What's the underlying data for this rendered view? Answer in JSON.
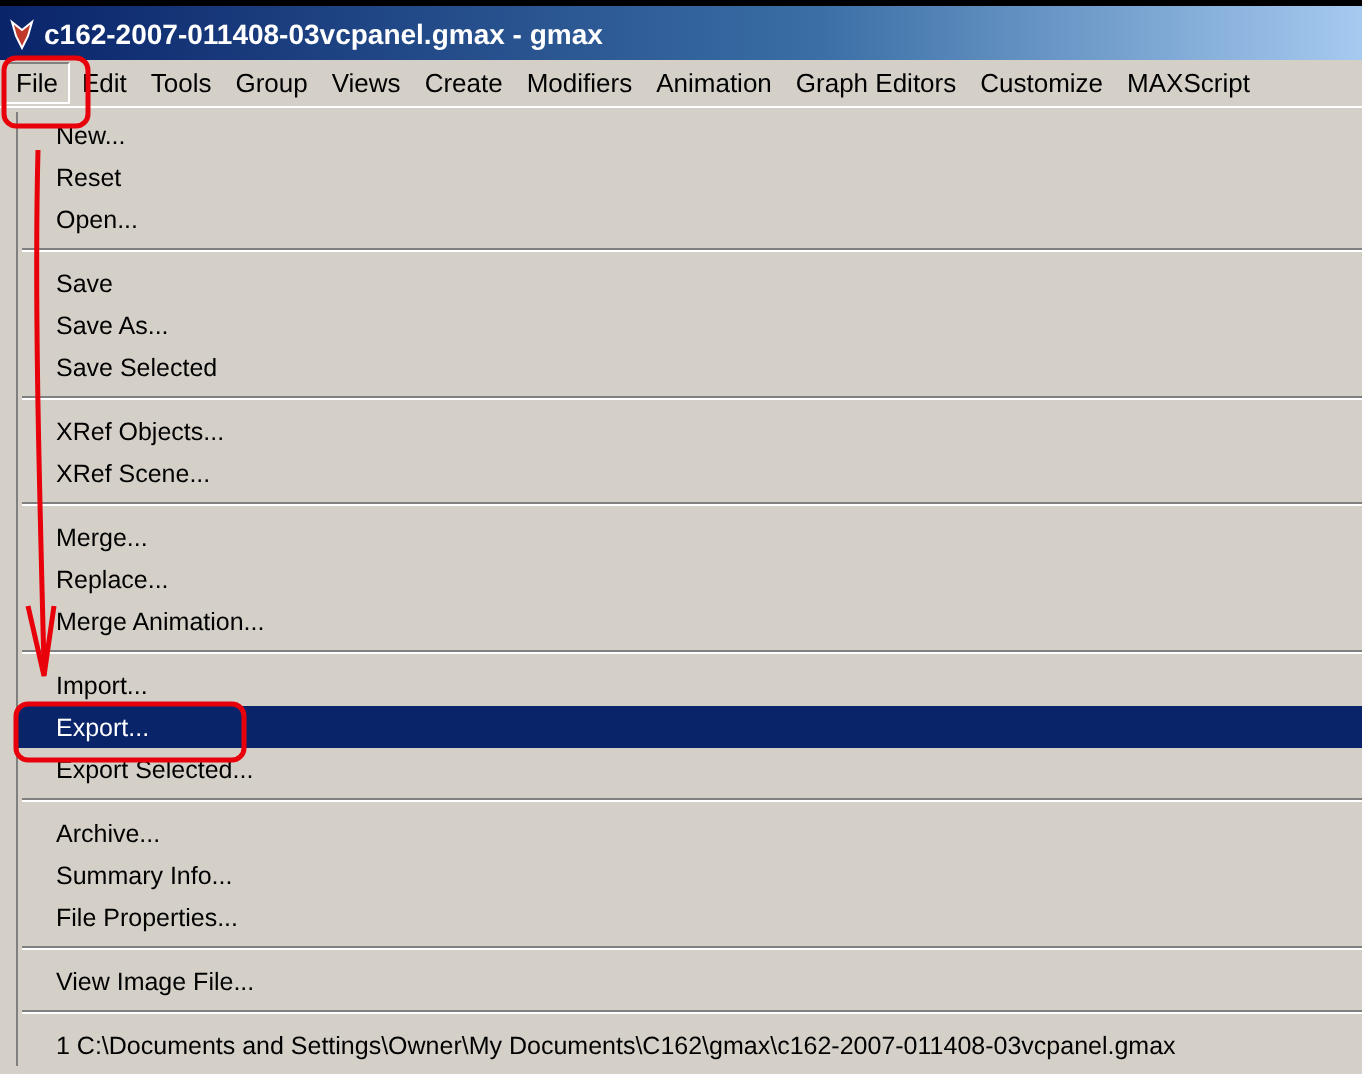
{
  "window": {
    "title": "c162-2007-011408-03vcpanel.gmax - gmax"
  },
  "menubar": [
    {
      "label": "File",
      "selected": true
    },
    {
      "label": "Edit",
      "selected": false
    },
    {
      "label": "Tools",
      "selected": false
    },
    {
      "label": "Group",
      "selected": false
    },
    {
      "label": "Views",
      "selected": false
    },
    {
      "label": "Create",
      "selected": false
    },
    {
      "label": "Modifiers",
      "selected": false
    },
    {
      "label": "Animation",
      "selected": false
    },
    {
      "label": "Graph Editors",
      "selected": false
    },
    {
      "label": "Customize",
      "selected": false
    },
    {
      "label": "MAXScript",
      "selected": false
    }
  ],
  "file_menu": {
    "groups": [
      {
        "items": [
          {
            "label": "New...",
            "selected": false
          },
          {
            "label": "Reset",
            "selected": false
          },
          {
            "label": "Open...",
            "selected": false
          }
        ]
      },
      {
        "items": [
          {
            "label": "Save",
            "selected": false
          },
          {
            "label": "Save As...",
            "selected": false
          },
          {
            "label": "Save Selected",
            "selected": false
          }
        ]
      },
      {
        "items": [
          {
            "label": "XRef Objects...",
            "selected": false
          },
          {
            "label": "XRef Scene...",
            "selected": false
          }
        ]
      },
      {
        "items": [
          {
            "label": "Merge...",
            "selected": false
          },
          {
            "label": "Replace...",
            "selected": false
          },
          {
            "label": "Merge Animation...",
            "selected": false
          }
        ]
      },
      {
        "items": [
          {
            "label": "Import...",
            "selected": false
          },
          {
            "label": "Export...",
            "selected": true
          },
          {
            "label": "Export Selected...",
            "selected": false
          }
        ]
      },
      {
        "items": [
          {
            "label": "Archive...",
            "selected": false
          },
          {
            "label": "Summary Info...",
            "selected": false
          },
          {
            "label": "File Properties...",
            "selected": false
          }
        ]
      },
      {
        "items": [
          {
            "label": "View Image File...",
            "selected": false
          }
        ]
      },
      {
        "items": [
          {
            "label": "1 C:\\Documents and Settings\\Owner\\My Documents\\C162\\gmax\\c162-2007-011408-03vcpanel.gmax",
            "selected": false
          }
        ]
      }
    ]
  }
}
